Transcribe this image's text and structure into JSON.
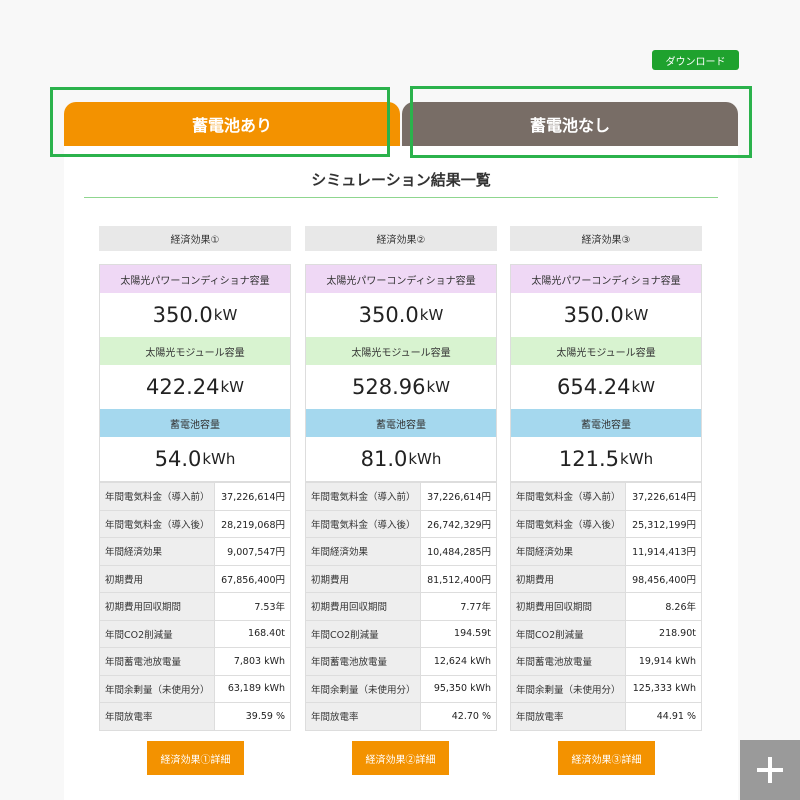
{
  "header": {
    "download_label": "ダウンロード"
  },
  "tabs": [
    {
      "label": "蓄電池あり",
      "active": true
    },
    {
      "label": "蓄電池なし",
      "active": false
    }
  ],
  "title": "シミュレーション結果一覧",
  "labels": {
    "pcs": "太陽光パワーコンディショナ容量",
    "module": "太陽光モジュール容量",
    "battery": "蓄電池容量"
  },
  "columns": [
    {
      "heading": "経済効果①",
      "pcs_value": "350.0",
      "pcs_unit": "kW",
      "module_value": "422.24",
      "module_unit": "kW",
      "battery_value": "54.0",
      "battery_unit": "kWh",
      "metrics": [
        {
          "label": "年間電気料金（導入前）",
          "value": "37,226,614円"
        },
        {
          "label": "年間電気料金（導入後）",
          "value": "28,219,068円"
        },
        {
          "label": "年間経済効果",
          "value": "9,007,547円"
        },
        {
          "label": "初期費用",
          "value": "67,856,400円"
        },
        {
          "label": "初期費用回収期間",
          "value": "7.53年"
        },
        {
          "label": "年間CO2削減量",
          "value": "168.40t"
        },
        {
          "label": "年間蓄電池放電量",
          "value": "7,803 kWh"
        },
        {
          "label": "年間余剰量（未使用分）",
          "value": "63,189 kWh"
        },
        {
          "label": "年間放電率",
          "value": "39.59 %"
        }
      ],
      "detail_label": "経済効果①詳細"
    },
    {
      "heading": "経済効果②",
      "pcs_value": "350.0",
      "pcs_unit": "kW",
      "module_value": "528.96",
      "module_unit": "kW",
      "battery_value": "81.0",
      "battery_unit": "kWh",
      "metrics": [
        {
          "label": "年間電気料金（導入前）",
          "value": "37,226,614円"
        },
        {
          "label": "年間電気料金（導入後）",
          "value": "26,742,329円"
        },
        {
          "label": "年間経済効果",
          "value": "10,484,285円"
        },
        {
          "label": "初期費用",
          "value": "81,512,400円"
        },
        {
          "label": "初期費用回収期間",
          "value": "7.77年"
        },
        {
          "label": "年間CO2削減量",
          "value": "194.59t"
        },
        {
          "label": "年間蓄電池放電量",
          "value": "12,624 kWh"
        },
        {
          "label": "年間余剰量（未使用分）",
          "value": "95,350 kWh"
        },
        {
          "label": "年間放電率",
          "value": "42.70 %"
        }
      ],
      "detail_label": "経済効果②詳細"
    },
    {
      "heading": "経済効果③",
      "pcs_value": "350.0",
      "pcs_unit": "kW",
      "module_value": "654.24",
      "module_unit": "kW",
      "battery_value": "121.5",
      "battery_unit": "kWh",
      "metrics": [
        {
          "label": "年間電気料金（導入前）",
          "value": "37,226,614円"
        },
        {
          "label": "年間電気料金（導入後）",
          "value": "25,312,199円"
        },
        {
          "label": "年間経済効果",
          "value": "11,914,413円"
        },
        {
          "label": "初期費用",
          "value": "98,456,400円"
        },
        {
          "label": "初期費用回収期間",
          "value": "8.26年"
        },
        {
          "label": "年間CO2削減量",
          "value": "218.90t"
        },
        {
          "label": "年間蓄電池放電量",
          "value": "19,914 kWh"
        },
        {
          "label": "年間余剰量（未使用分）",
          "value": "125,333 kWh"
        },
        {
          "label": "年間放電率",
          "value": "44.91 %"
        }
      ],
      "detail_label": "経済効果③詳細"
    }
  ],
  "colors": {
    "accent_orange": "#f39200",
    "tab_gray": "#786d66",
    "download_green": "#1fa22e",
    "highlight_green": "#2bb24c"
  },
  "icons": {
    "expand": "plus-icon"
  }
}
